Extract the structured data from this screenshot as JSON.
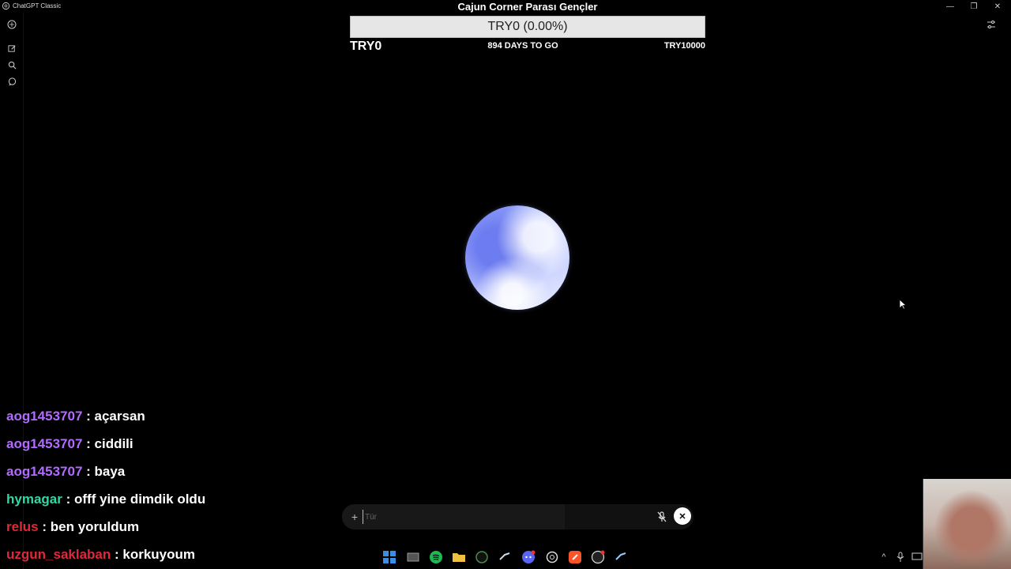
{
  "window": {
    "app_name": "ChatGPT Classic",
    "title": "Cajun Corner Parası Gençler",
    "minimize": "—",
    "maximize": "❐",
    "close": "✕"
  },
  "goal": {
    "bar_text": "TRY0 (0.00%)",
    "current": "TRY0",
    "days_left": "894 DAYS TO GO",
    "target": "TRY10000",
    "progress_fraction": 0.0
  },
  "chat": [
    {
      "user": "aog1453707",
      "sep": " : ",
      "message": "açarsan",
      "color": "#b26bff"
    },
    {
      "user": "aog1453707",
      "sep": " : ",
      "message": "ciddili",
      "color": "#b26bff"
    },
    {
      "user": "aog1453707",
      "sep": " : ",
      "message": "baya",
      "color": "#b26bff"
    },
    {
      "user": "hymagar",
      "sep": " : ",
      "message": "offf yine dimdik oldu",
      "color": "#2fd9a6"
    },
    {
      "user": "relus",
      "sep": " : ",
      "message": "ben yoruldum",
      "color": "#e02a38"
    },
    {
      "user": "uzgun_saklaban",
      "sep": " : ",
      "message": "korkuyoum",
      "color": "#e0283a"
    }
  ],
  "input": {
    "placeholder": "Tür",
    "value": ""
  },
  "colors": {
    "background": "#000000",
    "goal_bar_bg": "#e6e6e6",
    "orb_primary": "#8fa0ff"
  },
  "taskbar": {
    "icons": [
      "windows-start-icon",
      "task-view-icon",
      "spotify-icon",
      "file-explorer-icon",
      "chatgpt-app-icon",
      "steam-icon",
      "discord-icon",
      "chatgpt-icon",
      "brave-icon",
      "obs-icon",
      "steam-icon-2"
    ],
    "tray": [
      "chevron-up-icon",
      "microphone-icon",
      "display-icon"
    ]
  }
}
